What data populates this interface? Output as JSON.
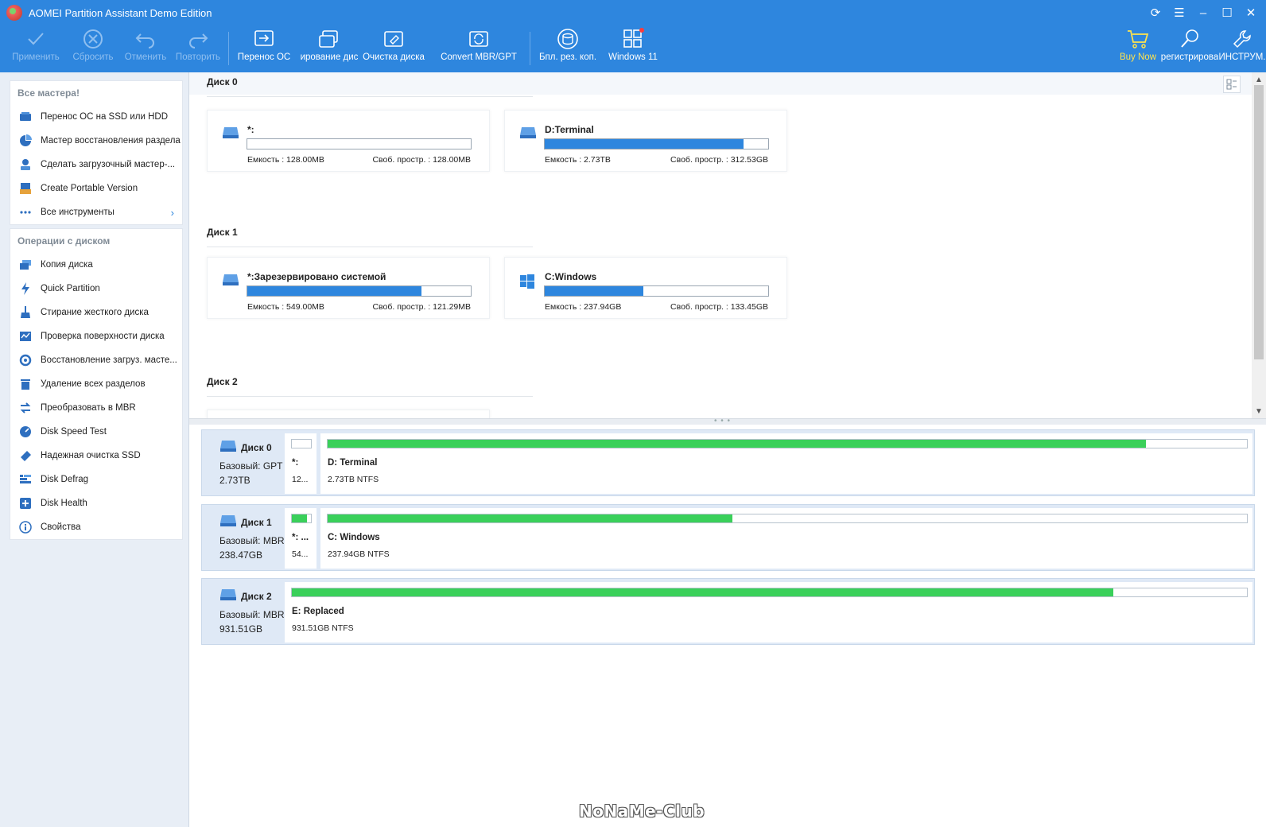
{
  "window": {
    "title": "AOMEI Partition Assistant Demo Edition"
  },
  "colors": {
    "accent": "#2e86de",
    "used_bar": "#2e86de",
    "map_bar": "#3ad05a",
    "buy": "#ffe34d"
  },
  "toolbar": {
    "apply": "Применить",
    "reset": "Сбросить",
    "undo": "Отменить",
    "redo": "Повторить",
    "migrate_os": "Перенос ОС",
    "clone_disk": "ирование дис",
    "wipe_disk": "Очистка диска",
    "convert": "Convert MBR/GPT",
    "free_backup": "Бпл. рез. коп.",
    "windows11": "Windows 11",
    "buy_now": "Buy Now",
    "register": "регистрирова",
    "tools": "ИНСТРУМ."
  },
  "sidebar": {
    "wizards_title": "Все мастера!",
    "wizards": [
      {
        "label": "Перенос ОС на SSD или HDD",
        "icon": "migrate-icon"
      },
      {
        "label": "Мастер восстановления раздела",
        "icon": "recovery-icon"
      },
      {
        "label": "Сделать загрузочный мастер-...",
        "icon": "bootable-icon"
      },
      {
        "label": "Create Portable Version",
        "icon": "portable-icon"
      },
      {
        "label": "Все инструменты",
        "icon": "dots-icon"
      }
    ],
    "ops_title": "Операции с диском",
    "ops": [
      {
        "label": "Копия диска",
        "icon": "disk-copy-icon"
      },
      {
        "label": "Quick Partition",
        "icon": "lightning-icon"
      },
      {
        "label": "Стирание жесткого диска",
        "icon": "broom-icon"
      },
      {
        "label": "Проверка поверхности диска",
        "icon": "surface-test-icon"
      },
      {
        "label": "Восстановление загруз. масте...",
        "icon": "rebuild-mbr-icon"
      },
      {
        "label": "Удаление всех разделов",
        "icon": "trash-icon"
      },
      {
        "label": "Преобразовать в MBR",
        "icon": "convert-icon"
      },
      {
        "label": "Disk Speed Test",
        "icon": "speedometer-icon"
      },
      {
        "label": "Надежная очистка SSD",
        "icon": "eraser-icon"
      },
      {
        "label": "Disk Defrag",
        "icon": "defrag-icon"
      },
      {
        "label": "Disk Health",
        "icon": "health-icon"
      },
      {
        "label": "Свойства",
        "icon": "info-icon"
      }
    ]
  },
  "cards": {
    "disk0": "Диск 0",
    "disk1": "Диск 1",
    "disk2": "Диск 2",
    "cap_prefix": "Емкость : ",
    "free_prefix": "Своб. простр. : ",
    "partitions": [
      {
        "name": "*:",
        "capacity": "128.00MB",
        "free": "128.00MB",
        "used_fraction": 0.0
      },
      {
        "name": "D:Terminal",
        "capacity": "2.73TB",
        "free": "312.53GB",
        "used_fraction": 0.89
      },
      {
        "name": "*:Зарезервировано системой",
        "capacity": "549.00MB",
        "free": "121.29MB",
        "used_fraction": 0.78
      },
      {
        "name": "C:Windows",
        "capacity": "237.94GB",
        "free": "133.45GB",
        "used_fraction": 0.44
      }
    ]
  },
  "map": {
    "disks": [
      {
        "name": "Диск 0",
        "type": "Базовый: GPT",
        "size": "2.73TB",
        "parts": [
          {
            "name": "*:",
            "info": "12...",
            "used_fraction": 0.0
          },
          {
            "name": "D: Terminal",
            "info": "2.73TB NTFS",
            "used_fraction": 0.89
          }
        ]
      },
      {
        "name": "Диск 1",
        "type": "Базовый: MBR",
        "size": "238.47GB",
        "parts": [
          {
            "name": "*: ...",
            "info": "54...",
            "used_fraction": 0.78
          },
          {
            "name": "C: Windows",
            "info": "237.94GB NTFS",
            "used_fraction": 0.44
          }
        ]
      },
      {
        "name": "Диск 2",
        "type": "Базовый: MBR",
        "size": "931.51GB",
        "parts": [
          {
            "name": "E: Replaced",
            "info": "931.51GB NTFS",
            "used_fraction": 0.86
          }
        ]
      }
    ]
  },
  "watermark": "NoNaMe-Club"
}
